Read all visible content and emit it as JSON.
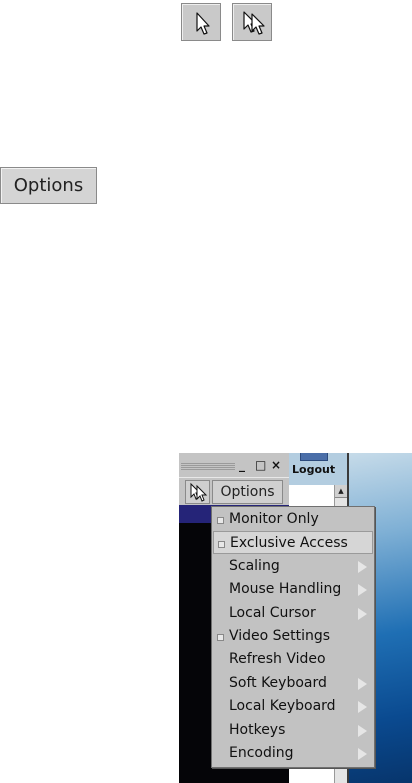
{
  "top_buttons": [
    {
      "icon": "arrow-cursor-icon"
    },
    {
      "icon": "double-cursor-icon"
    }
  ],
  "options_button": {
    "label": "Options"
  },
  "window": {
    "controls": [
      "_",
      "□",
      "×"
    ],
    "logout_label": "Logout",
    "toolbar_options_label": "Options",
    "scroll_up": "▲"
  },
  "menu": {
    "items": [
      {
        "label": "Monitor Only",
        "check": true,
        "arrow": false
      },
      {
        "label": "Exclusive Access",
        "check": true,
        "arrow": false
      },
      {
        "label": "Scaling",
        "check": false,
        "arrow": true
      },
      {
        "label": "Mouse Handling",
        "check": false,
        "arrow": true
      },
      {
        "label": "Local Cursor",
        "check": false,
        "arrow": true
      },
      {
        "label": "Video Settings",
        "check": true,
        "arrow": false
      },
      {
        "label": "Refresh Video",
        "check": false,
        "arrow": false
      },
      {
        "label": "Soft Keyboard",
        "check": false,
        "arrow": true
      },
      {
        "label": "Local Keyboard",
        "check": false,
        "arrow": true
      },
      {
        "label": "Hotkeys",
        "check": false,
        "arrow": true
      },
      {
        "label": "Encoding",
        "check": false,
        "arrow": true
      }
    ],
    "highlighted": "Exclusive Access"
  }
}
